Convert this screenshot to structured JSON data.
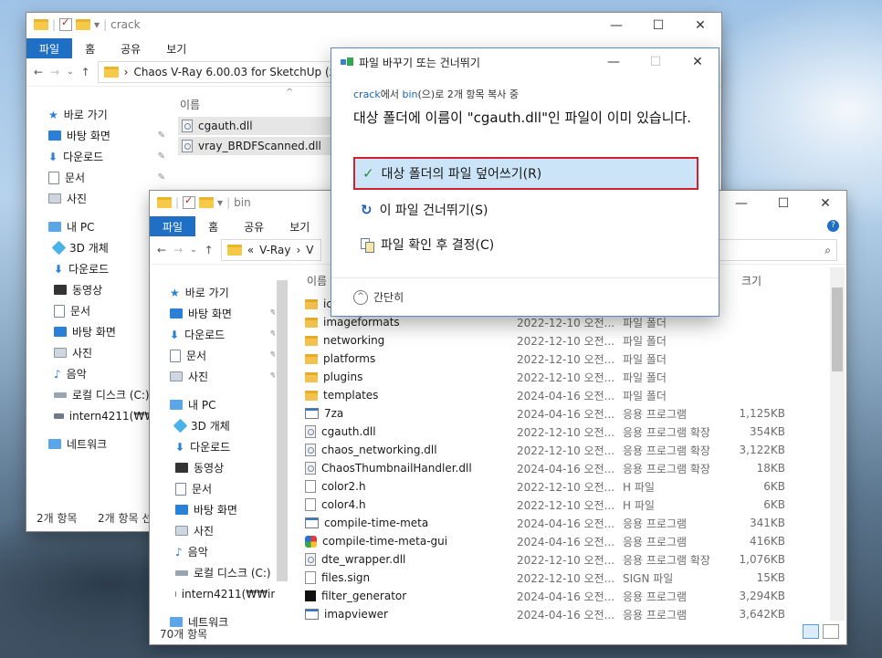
{
  "icons": {
    "folder": "folder-icon",
    "check": "check-icon",
    "skip": "skip-icon",
    "compare": "compare-icon"
  },
  "accent": "#1f6fc4",
  "highlight_border": "#d01f2e",
  "crack_window": {
    "title": "crack",
    "tabs": [
      "파일",
      "홈",
      "공유",
      "보기"
    ],
    "address": "Chaos V-Ray 6.00.03 for SketchUp (x6",
    "column_name": "이름",
    "files": [
      "cgauth.dll",
      "vray_BRDFScanned.dll"
    ],
    "nav": [
      {
        "label": "바로 가기",
        "pin": false
      },
      {
        "label": "바탕 화면",
        "pin": true
      },
      {
        "label": "다운로드",
        "pin": true
      },
      {
        "label": "문서",
        "pin": true
      },
      {
        "label": "사진",
        "pin": false
      },
      {
        "label": "내 PC",
        "pin": false
      },
      {
        "label": "3D 개체",
        "pin": false
      },
      {
        "label": "다운로드",
        "pin": false
      },
      {
        "label": "동영상",
        "pin": false
      },
      {
        "label": "문서",
        "pin": false
      },
      {
        "label": "바탕 화면",
        "pin": false
      },
      {
        "label": "사진",
        "pin": false
      },
      {
        "label": "음악",
        "pin": false
      },
      {
        "label": "로컬 디스크 (C:)",
        "pin": false
      },
      {
        "label": "intern4211(₩₩in",
        "pin": false
      },
      {
        "label": "네트워크",
        "pin": false
      }
    ],
    "status_left": "2개 항목",
    "status_right": "2개 항목 선"
  },
  "bin_window": {
    "title": "bin",
    "tabs": [
      "파일",
      "홈",
      "공유",
      "보기"
    ],
    "address_prefix": "«",
    "address_a": "V-Ray",
    "address_b": "V",
    "column_name": "이름",
    "column_size": "크기",
    "nav": [
      {
        "label": "바로 가기",
        "pin": false
      },
      {
        "label": "바탕 화면",
        "pin": true
      },
      {
        "label": "다운로드",
        "pin": true
      },
      {
        "label": "문서",
        "pin": true
      },
      {
        "label": "사진",
        "pin": true
      },
      {
        "label": "내 PC",
        "pin": false
      },
      {
        "label": "3D 개체",
        "pin": false
      },
      {
        "label": "다운로드",
        "pin": false
      },
      {
        "label": "동영상",
        "pin": false
      },
      {
        "label": "문서",
        "pin": false
      },
      {
        "label": "바탕 화면",
        "pin": false
      },
      {
        "label": "사진",
        "pin": false
      },
      {
        "label": "음악",
        "pin": false
      },
      {
        "label": "로컬 디스크 (C:)",
        "pin": false
      },
      {
        "label": "intern4211(₩₩in",
        "pin": false
      },
      {
        "label": "네트워크",
        "pin": false
      }
    ],
    "rows": [
      {
        "name": "ic",
        "date": "",
        "type": "",
        "size": "",
        "icon": "folder"
      },
      {
        "name": "imageformats",
        "date": "2022-12-10 오전...",
        "type": "파일 폴더",
        "size": "",
        "icon": "folder"
      },
      {
        "name": "networking",
        "date": "2022-12-10 오전...",
        "type": "파일 폴더",
        "size": "",
        "icon": "folder"
      },
      {
        "name": "platforms",
        "date": "2022-12-10 오전...",
        "type": "파일 폴더",
        "size": "",
        "icon": "folder"
      },
      {
        "name": "plugins",
        "date": "2022-12-10 오전...",
        "type": "파일 폴더",
        "size": "",
        "icon": "folder"
      },
      {
        "name": "templates",
        "date": "2024-04-16 오전...",
        "type": "파일 폴더",
        "size": "",
        "icon": "folder"
      },
      {
        "name": "7za",
        "date": "2024-04-16 오전...",
        "type": "응용 프로그램",
        "size": "1,125KB",
        "icon": "exe"
      },
      {
        "name": "cgauth.dll",
        "date": "2022-12-10 오전...",
        "type": "응용 프로그램 확장",
        "size": "354KB",
        "icon": "dll"
      },
      {
        "name": "chaos_networking.dll",
        "date": "2022-12-10 오전...",
        "type": "응용 프로그램 확장",
        "size": "3,122KB",
        "icon": "dll"
      },
      {
        "name": "ChaosThumbnailHandler.dll",
        "date": "2024-04-16 오전...",
        "type": "응용 프로그램 확장",
        "size": "18KB",
        "icon": "dll"
      },
      {
        "name": "color2.h",
        "date": "2022-12-10 오전...",
        "type": "H 파일",
        "size": "6KB",
        "icon": "file"
      },
      {
        "name": "color4.h",
        "date": "2022-12-10 오전...",
        "type": "H 파일",
        "size": "6KB",
        "icon": "file"
      },
      {
        "name": "compile-time-meta",
        "date": "2024-04-16 오전...",
        "type": "응용 프로그램",
        "size": "341KB",
        "icon": "exe"
      },
      {
        "name": "compile-time-meta-gui",
        "date": "2024-04-16 오전...",
        "type": "응용 프로그램",
        "size": "416KB",
        "icon": "gui"
      },
      {
        "name": "dte_wrapper.dll",
        "date": "2022-12-10 오전...",
        "type": "응용 프로그램 확장",
        "size": "1,076KB",
        "icon": "dll"
      },
      {
        "name": "files.sign",
        "date": "2022-12-10 오전...",
        "type": "SIGN 파일",
        "size": "15KB",
        "icon": "file"
      },
      {
        "name": "filter_generator",
        "date": "2024-04-16 오전...",
        "type": "응용 프로그램",
        "size": "3,294KB",
        "icon": "black"
      },
      {
        "name": "imapviewer",
        "date": "2024-04-16 오전...",
        "type": "응용 프로그램",
        "size": "3,642KB",
        "icon": "exe"
      }
    ],
    "status": "70개 항목"
  },
  "dialog": {
    "title": "파일 바꾸기 또는 건너뛰기",
    "src": "crack",
    "mid1": "에서 ",
    "dst": "bin",
    "mid2": "(으)로 2개 항목 복사 중",
    "headline": "대상 폴더에 이름이 \"cgauth.dll\"인 파일이 이미 있습니다.",
    "option_replace": "대상 폴더의 파일 덮어쓰기(R)",
    "option_skip": "이 파일 건너뛰기(S)",
    "option_compare": "파일 확인 후 결정(C)",
    "fewer": "간단히"
  }
}
